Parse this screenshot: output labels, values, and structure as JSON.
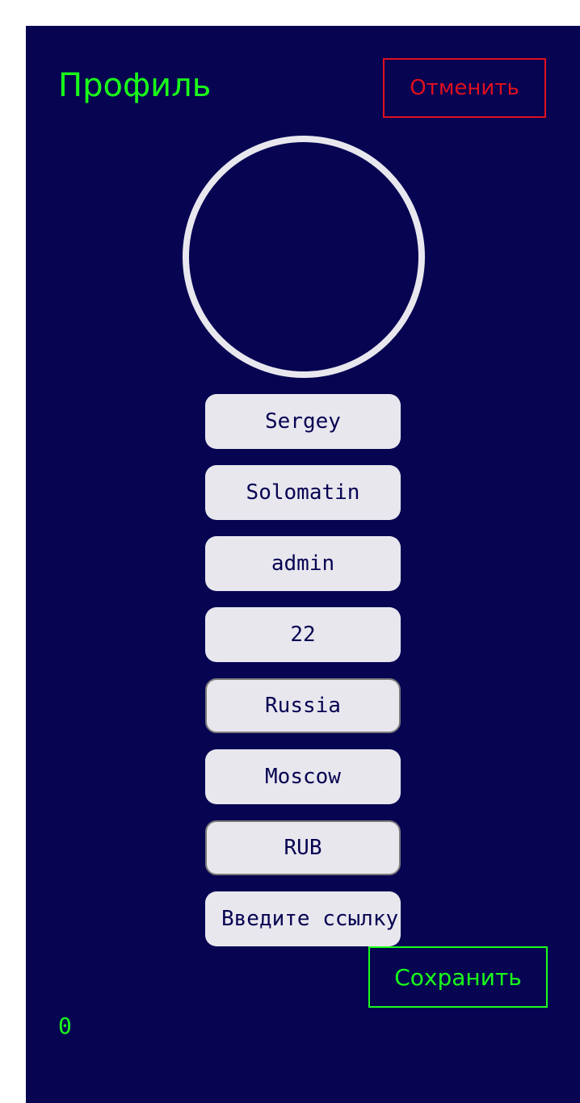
{
  "header": {
    "title": "Профиль",
    "cancel_label": "Отменить"
  },
  "fields": {
    "first_name": "Sergey",
    "last_name": "Solomatin",
    "username": "admin",
    "age": "22",
    "country": "Russia",
    "city": "Moscow",
    "currency": "RUB",
    "avatar_url_placeholder": "Введите ссылку"
  },
  "footer": {
    "save_label": "Сохранить",
    "counter": "0"
  },
  "colors": {
    "background": "#070452",
    "accent_green": "#1aff1a",
    "accent_red": "#e0101e",
    "field_bg": "#e8e7ee"
  }
}
